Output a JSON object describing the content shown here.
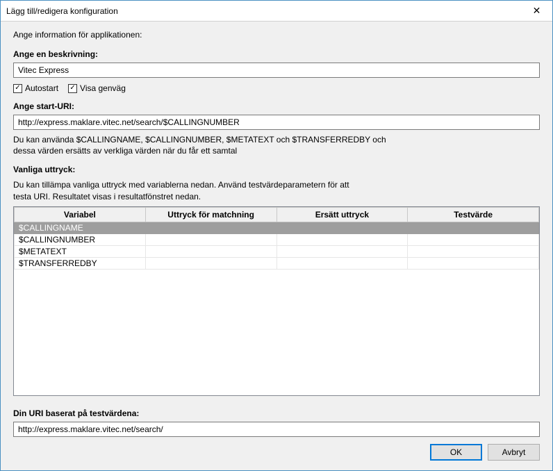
{
  "window": {
    "title": "Lägg till/redigera konfiguration"
  },
  "labels": {
    "intro": "Ange information för applikationen:",
    "description_header": "Ange en beskrivning:",
    "autostart": "Autostart",
    "show_shortcut": "Visa genväg",
    "start_uri_header": "Ange start-URI:",
    "uri_info_line1": "Du kan använda $CALLINGNAME, $CALLINGNUMBER, $METATEXT och $TRANSFERREDBY och",
    "uri_info_line2": "dessa värden ersätts av verkliga värden när du får ett samtal",
    "regex_header": "Vanliga uttryck:",
    "regex_info_line1": "Du kan tillämpa vanliga uttryck med variablerna nedan. Använd testvärdeparametern för att",
    "regex_info_line2": " testa URI. Resultatet visas i resultatfönstret nedan.",
    "result_header": "Din URI baserat på testvärdena:",
    "ok": "OK",
    "cancel": "Avbryt",
    "checkmark": "✓"
  },
  "fields": {
    "description": "Vitec Express",
    "start_uri": "http://express.maklare.vitec.net/search/$CALLINGNUMBER",
    "result_uri": "http://express.maklare.vitec.net/search/",
    "autostart_checked": true,
    "show_shortcut_checked": true
  },
  "table": {
    "headers": {
      "variable": "Variabel",
      "match_expr": "Uttryck för matchning",
      "replace_expr": "Ersätt uttryck",
      "test_value": "Testvärde"
    },
    "rows": [
      {
        "variable": "$CALLINGNAME",
        "match_expr": "",
        "replace_expr": "",
        "test_value": "",
        "selected": true
      },
      {
        "variable": "$CALLINGNUMBER",
        "match_expr": "",
        "replace_expr": "",
        "test_value": "",
        "selected": false
      },
      {
        "variable": "$METATEXT",
        "match_expr": "",
        "replace_expr": "",
        "test_value": "",
        "selected": false
      },
      {
        "variable": "$TRANSFERREDBY",
        "match_expr": "",
        "replace_expr": "",
        "test_value": "",
        "selected": false
      }
    ]
  }
}
